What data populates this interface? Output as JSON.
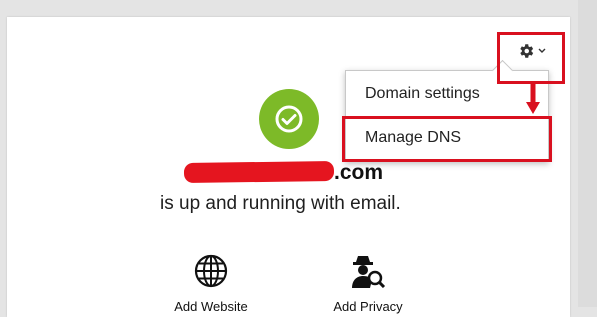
{
  "domain": {
    "suffix": ".com"
  },
  "status": {
    "message": "is up and running with email."
  },
  "settings_menu": {
    "gear_icon": "gear-icon",
    "chevron_icon": "chevron-down-icon",
    "items": [
      {
        "label": "Domain settings"
      },
      {
        "label": "Manage DNS"
      }
    ]
  },
  "actions": [
    {
      "label": "Add Website",
      "icon": "globe-icon"
    },
    {
      "label": "Add Privacy",
      "icon": "privacy-agent-icon"
    }
  ],
  "colors": {
    "success_green": "#7dba28",
    "annotation_red": "#d9101f",
    "redaction_red": "#e5151f"
  }
}
